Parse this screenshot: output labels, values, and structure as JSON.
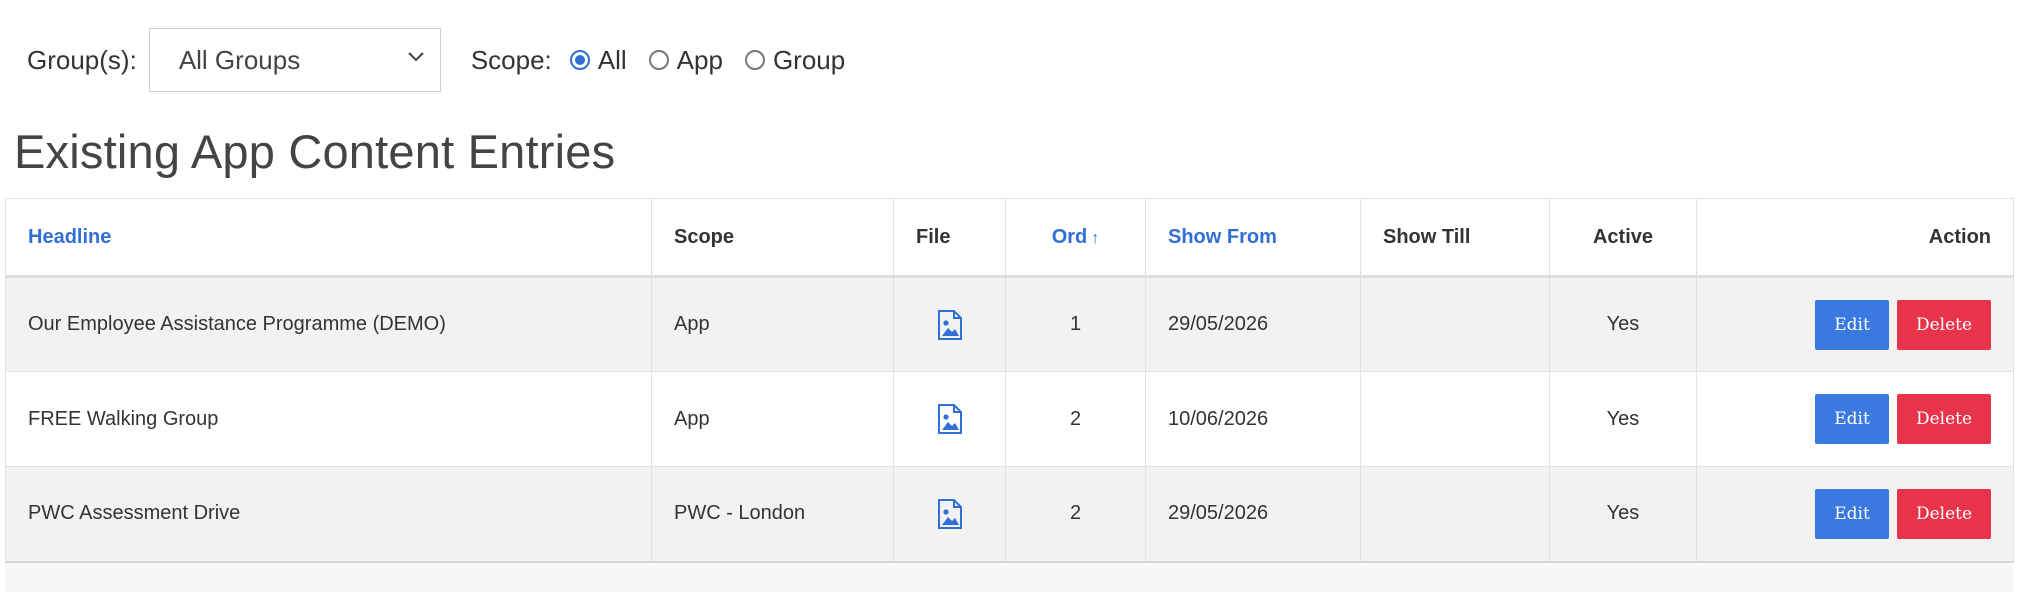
{
  "filters": {
    "group_label": "Group(s):",
    "group_selected": "All Groups",
    "scope_label": "Scope:",
    "scope_options": [
      {
        "label": "All",
        "checked": true
      },
      {
        "label": "App",
        "checked": false
      },
      {
        "label": "Group",
        "checked": false
      }
    ]
  },
  "title": "Existing App Content Entries",
  "table": {
    "columns": [
      {
        "label": "Headline",
        "sortable": true
      },
      {
        "label": "Scope",
        "sortable": false
      },
      {
        "label": "File",
        "sortable": false
      },
      {
        "label": "Ord",
        "sortable": true,
        "sort_indicator": "↑"
      },
      {
        "label": "Show From",
        "sortable": true
      },
      {
        "label": "Show Till",
        "sortable": false
      },
      {
        "label": "Active",
        "sortable": false
      },
      {
        "label": "Action",
        "sortable": false
      }
    ],
    "rows": [
      {
        "headline": "Our Employee Assistance Programme (DEMO)",
        "scope": "App",
        "file_icon": "image-file-icon",
        "ord": "1",
        "show_from": "29/05/2026",
        "show_till": "",
        "active": "Yes",
        "edit_label": "Edit",
        "delete_label": "Delete"
      },
      {
        "headline": "FREE Walking Group",
        "scope": "App",
        "file_icon": "image-file-icon",
        "ord": "2",
        "show_from": "10/06/2026",
        "show_till": "",
        "active": "Yes",
        "edit_label": "Edit",
        "delete_label": "Delete"
      },
      {
        "headline": "PWC Assessment Drive",
        "scope": "PWC - London",
        "file_icon": "image-file-icon",
        "ord": "2",
        "show_from": "29/05/2026",
        "show_till": "",
        "active": "Yes",
        "edit_label": "Edit",
        "delete_label": "Delete"
      }
    ]
  },
  "colors": {
    "accent": "#2f6fd6",
    "edit_button": "#3a7ae0",
    "delete_button": "#e8344a",
    "row_stripe": "#f2f2f2"
  }
}
